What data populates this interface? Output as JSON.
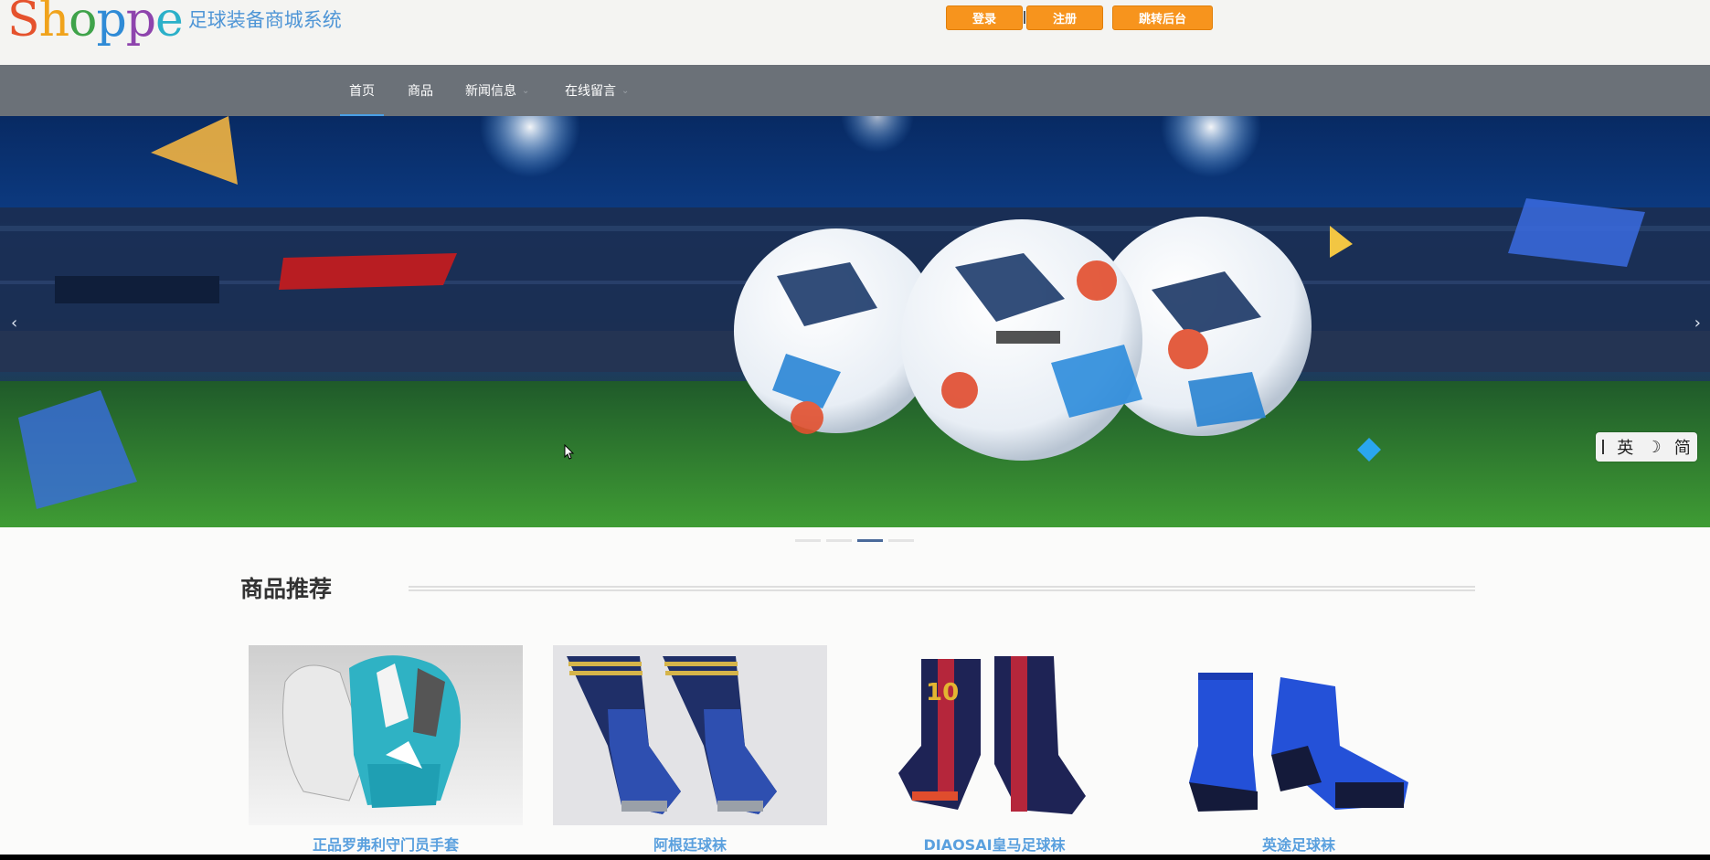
{
  "header": {
    "logo_text": "Shoppe",
    "logo_letters": [
      "S",
      "h",
      "o",
      "p",
      "p",
      "e"
    ],
    "site_name": "足球装备商城系统",
    "buttons": {
      "login": "登录",
      "register": "注册",
      "admin": "跳转后台"
    }
  },
  "nav": {
    "items": [
      {
        "label": "首页"
      },
      {
        "label": "商品"
      },
      {
        "label": "新闻信息"
      },
      {
        "label": "在线留言"
      }
    ],
    "caret": "⌄"
  },
  "banner": {
    "prev": "‹",
    "next": "›",
    "indicator_count": 4,
    "active_indicator": 3,
    "ime": {
      "lang": "英",
      "mode": "☽",
      "script": "简"
    }
  },
  "section": {
    "title": "商品推荐",
    "products": [
      {
        "name": "正品罗弗利守门员手套"
      },
      {
        "name": "阿根廷球袜"
      },
      {
        "name": "DIAOSAI皇马足球袜"
      },
      {
        "name": "英途足球袜"
      }
    ]
  },
  "colors": {
    "accent": "#f7941d",
    "nav_bg": "#6b7178",
    "link": "#5aa0de"
  }
}
